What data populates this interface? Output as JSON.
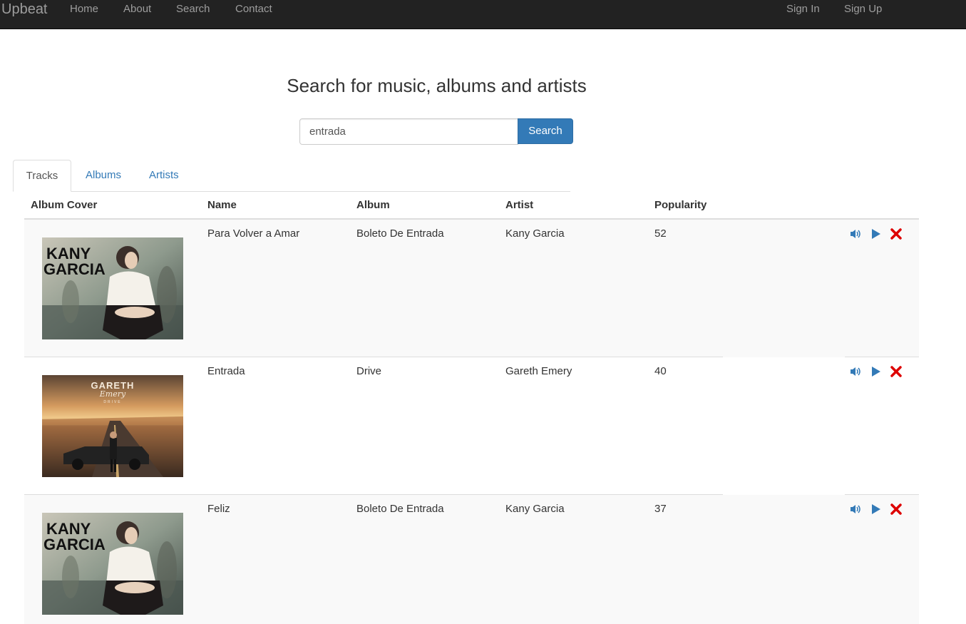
{
  "nav": {
    "brand": "Upbeat",
    "links": [
      "Home",
      "About",
      "Search",
      "Contact"
    ],
    "right_links": [
      "Sign In",
      "Sign Up"
    ]
  },
  "search": {
    "heading": "Search for music, albums and artists",
    "query": "entrada",
    "button_label": "Search"
  },
  "tabs": [
    {
      "label": "Tracks",
      "active": true
    },
    {
      "label": "Albums",
      "active": false
    },
    {
      "label": "Artists",
      "active": false
    }
  ],
  "table": {
    "headers": [
      "Album Cover",
      "Name",
      "Album",
      "Artist",
      "Popularity"
    ],
    "rows": [
      {
        "name": "Para Volver a Amar",
        "album": "Boleto De Entrada",
        "artist": "Kany Garcia",
        "popularity": "52",
        "cover": "kany-garcia-cover",
        "cover_text": [
          "KANY",
          "GARCIA"
        ]
      },
      {
        "name": "Entrada",
        "album": "Drive",
        "artist": "Gareth Emery",
        "popularity": "40",
        "cover": "gareth-emery-drive-cover",
        "cover_text": [
          "GARETH",
          "Emery",
          "DRIVE"
        ]
      },
      {
        "name": "Feliz",
        "album": "Boleto De Entrada",
        "artist": "Kany Garcia",
        "popularity": "37",
        "cover": "kany-garcia-cover",
        "cover_text": [
          "KANY",
          "GARCIA"
        ]
      }
    ]
  },
  "actions": [
    "volume-icon",
    "play-icon",
    "remove-icon"
  ],
  "colors": {
    "navbar": "#222222",
    "nav_text": "#9d9d9d",
    "primary": "#337ab7",
    "remove": "#dd0000",
    "stripe": "#f9f9f9"
  }
}
